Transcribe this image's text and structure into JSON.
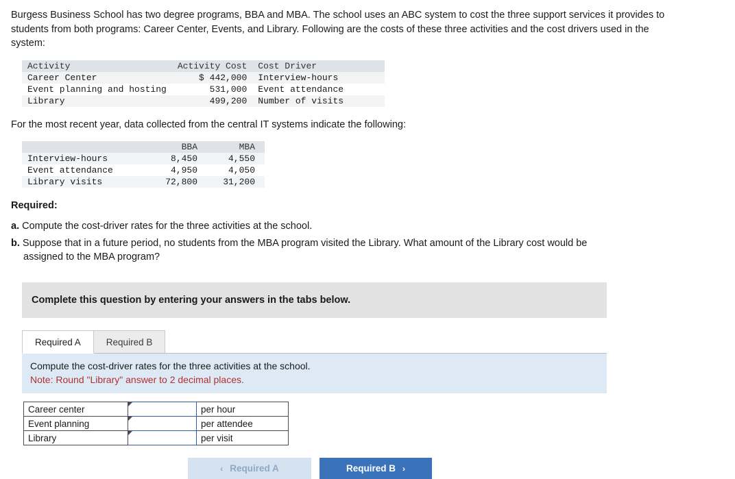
{
  "intro": "Burgess Business School has two degree programs, BBA and MBA. The school uses an ABC system to cost the three support services it provides to students from both programs: Career Center, Events, and Library. Following are the costs of these three activities and the cost drivers used in the system:",
  "activity_table": {
    "headers": [
      "Activity",
      "Activity Cost",
      "Cost Driver"
    ],
    "rows": [
      [
        "Career Center",
        "$ 442,000",
        "Interview-hours"
      ],
      [
        "Event planning and hosting",
        "531,000",
        "Event attendance"
      ],
      [
        "Library",
        "499,200",
        "Number of visits"
      ]
    ]
  },
  "mid_text": "For the most recent year, data collected from the central IT systems indicate the following:",
  "driver_table": {
    "headers": [
      "",
      "BBA",
      "MBA"
    ],
    "rows": [
      [
        "Interview-hours",
        "8,450",
        "4,550"
      ],
      [
        "Event attendance",
        "4,950",
        "4,050"
      ],
      [
        "Library visits",
        "72,800",
        "31,200"
      ]
    ]
  },
  "required_heading": "Required:",
  "requirements": [
    {
      "letter": "a.",
      "text": "Compute the cost-driver rates for the three activities at the school."
    },
    {
      "letter": "b.",
      "text": "Suppose that in a future period, no students from the MBA program visited the Library. What amount of the Library cost would be",
      "continuation": "assigned to the MBA program?"
    }
  ],
  "instruction_bar": "Complete this question by entering your answers in the tabs below.",
  "tabs": [
    {
      "label": "Required A",
      "active": true
    },
    {
      "label": "Required B",
      "active": false
    }
  ],
  "panel": {
    "prompt": "Compute the cost-driver rates for the three activities at the school.",
    "note": "Note: Round \"Library\" answer to 2 decimal places."
  },
  "answer_rows": [
    {
      "label": "Career center",
      "value": "",
      "unit": "per hour"
    },
    {
      "label": "Event planning",
      "value": "",
      "unit": "per attendee"
    },
    {
      "label": "Library",
      "value": "",
      "unit": "per visit"
    }
  ],
  "nav": {
    "prev_label": "Required A",
    "prev_chevron": "‹",
    "next_label": "Required B",
    "next_chevron": "›"
  },
  "colors": {
    "accent": "#3b73ba",
    "panel": "#ddeaf6",
    "note": "#b03030",
    "grey_bar": "#e2e2e2"
  }
}
